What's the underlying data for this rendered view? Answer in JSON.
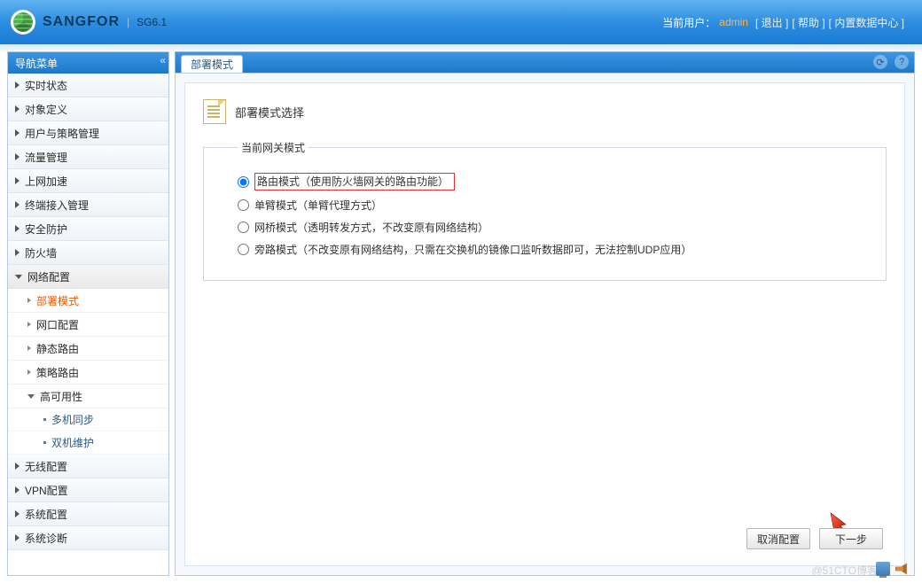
{
  "header": {
    "brand": "SANGFOR",
    "version": "SG6.1",
    "user_label": "当前用户：",
    "user_name": "admin",
    "logout": "[ 退出 ]",
    "help": "[ 帮助 ]",
    "data_center": "[ 内置数据中心 ]"
  },
  "sidebar": {
    "title": "导航菜单",
    "items": [
      {
        "label": "实时状态",
        "expanded": false
      },
      {
        "label": "对象定义",
        "expanded": false
      },
      {
        "label": "用户与策略管理",
        "expanded": false
      },
      {
        "label": "流量管理",
        "expanded": false
      },
      {
        "label": "上网加速",
        "expanded": false
      },
      {
        "label": "终端接入管理",
        "expanded": false
      },
      {
        "label": "安全防护",
        "expanded": false
      },
      {
        "label": "防火墙",
        "expanded": false
      },
      {
        "label": "网络配置",
        "expanded": true,
        "children": [
          {
            "label": "部署模式",
            "active": true
          },
          {
            "label": "网口配置"
          },
          {
            "label": "静态路由"
          },
          {
            "label": "策略路由"
          },
          {
            "label": "高可用性",
            "expandable": true,
            "children": [
              {
                "label": "多机同步"
              },
              {
                "label": "双机维护"
              }
            ]
          }
        ]
      },
      {
        "label": "无线配置",
        "expanded": false
      },
      {
        "label": "VPN配置",
        "expanded": false
      },
      {
        "label": "系统配置",
        "expanded": false
      },
      {
        "label": "系统诊断",
        "expanded": false
      }
    ]
  },
  "content": {
    "tab_label": "部署模式",
    "heading": "部署模式选择",
    "group_legend": "当前网关模式",
    "modes": [
      {
        "label": "路由模式（使用防火墙网关的路由功能）",
        "checked": true,
        "highlight": true
      },
      {
        "label": "单臂模式（单臂代理方式）"
      },
      {
        "label": "网桥模式（透明转发方式，不改变原有网络结构）"
      },
      {
        "label": "旁路模式（不改变原有网络结构，只需在交换机的镜像口监听数据即可，无法控制UDP应用）"
      }
    ],
    "buttons": {
      "cancel": "取消配置",
      "next": "下一步"
    }
  },
  "watermark": "@51CTO博客"
}
